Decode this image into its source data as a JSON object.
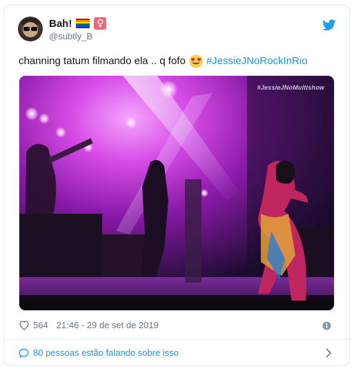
{
  "author": {
    "display_name": "Bah!",
    "handle": "@subtly_B",
    "venus_symbol": "♀"
  },
  "tweet": {
    "text_before": "channing tatum filmando ela .. q fofo",
    "hashtag": "#JessieJNoRockInRio"
  },
  "media": {
    "watermark": "#JessieJNoMultishow"
  },
  "meta": {
    "likes": "564",
    "timestamp": "21:46 - 29 de set de 2019"
  },
  "conversation": {
    "label": "80 pessoas estão falando sobre isso"
  },
  "icons": {
    "bird": "twitter-bird-icon",
    "heart": "heart-icon",
    "info": "info-icon",
    "bubble": "speech-bubble-icon",
    "chevron": "chevron-right-icon",
    "emoji": "heart-eyes-emoji"
  },
  "colors": {
    "twitter_blue": "#1da1f2",
    "link_blue": "#1b95e0",
    "meta_gray": "#657786",
    "border": "#e1e8ed",
    "stage_magenta": "#c43ad6"
  }
}
